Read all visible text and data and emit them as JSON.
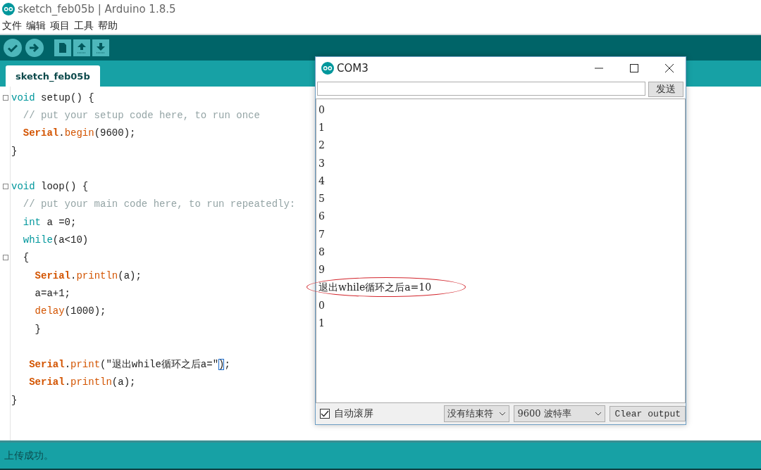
{
  "window": {
    "title": "sketch_feb05b | Arduino 1.8.5"
  },
  "menu": [
    "文件",
    "编辑",
    "项目",
    "工具",
    "帮助"
  ],
  "toolbar": [
    {
      "kind": "verify"
    },
    {
      "kind": "upload"
    },
    {
      "kind": "new"
    },
    {
      "kind": "open"
    },
    {
      "kind": "save"
    }
  ],
  "tabs": [
    {
      "label": "sketch_feb05b",
      "selected": true
    }
  ],
  "editor": {
    "lines": [
      {
        "fold": true,
        "tokens": [
          {
            "kind": "keyword",
            "text": "void"
          },
          {
            "kind": "plain",
            "text": " setup() {"
          }
        ]
      },
      {
        "fold": false,
        "tokens": [
          {
            "kind": "comment",
            "text": "  // put your setup code here, to run once"
          }
        ]
      },
      {
        "fold": false,
        "tokens": [
          {
            "kind": "class",
            "text": "  Serial"
          },
          {
            "kind": "plain",
            "text": "."
          },
          {
            "kind": "function",
            "text": "begin"
          },
          {
            "kind": "plain",
            "text": "(9600);"
          }
        ]
      },
      {
        "fold": false,
        "tokens": [
          {
            "kind": "plain",
            "text": "}"
          }
        ]
      },
      {
        "fold": false
      },
      {
        "fold": true,
        "tokens": [
          {
            "kind": "keyword",
            "text": "void"
          },
          {
            "kind": "plain",
            "text": " loop() {"
          }
        ]
      },
      {
        "fold": false,
        "tokens": [
          {
            "kind": "comment",
            "text": "  // put your main code here, to run repeatedly:"
          }
        ]
      },
      {
        "fold": false,
        "tokens": [
          {
            "kind": "keyword",
            "text": "  int"
          },
          {
            "kind": "plain",
            "text": " a =0;"
          }
        ]
      },
      {
        "fold": false,
        "tokens": [
          {
            "kind": "keyword",
            "text": "  while"
          },
          {
            "kind": "plain",
            "text": "(a<10)"
          }
        ]
      },
      {
        "fold": true,
        "tokens": [
          {
            "kind": "plain",
            "text": "  {"
          }
        ]
      },
      {
        "fold": false,
        "tokens": [
          {
            "kind": "class",
            "text": "    Serial"
          },
          {
            "kind": "plain",
            "text": "."
          },
          {
            "kind": "function",
            "text": "println"
          },
          {
            "kind": "plain",
            "text": "(a);"
          }
        ]
      },
      {
        "fold": false,
        "tokens": [
          {
            "kind": "plain",
            "text": "    a=a+1;"
          }
        ]
      },
      {
        "fold": false,
        "tokens": [
          {
            "kind": "function",
            "text": "    delay"
          },
          {
            "kind": "plain",
            "text": "(1000);"
          }
        ]
      },
      {
        "fold": false,
        "tokens": [
          {
            "kind": "plain",
            "text": "    }"
          }
        ]
      },
      {
        "fold": false
      },
      {
        "fold": false,
        "tokens": [
          {
            "kind": "class",
            "text": "   Serial"
          },
          {
            "kind": "plain",
            "text": "."
          },
          {
            "kind": "function",
            "text": "print"
          },
          {
            "kind": "plain",
            "text": "(\"退出while循环之后a=\""
          },
          {
            "kind": "match",
            "text": ")"
          },
          {
            "kind": "plain",
            "text": ";"
          }
        ]
      },
      {
        "fold": false,
        "tokens": [
          {
            "kind": "class",
            "text": "   Serial"
          },
          {
            "kind": "plain",
            "text": "."
          },
          {
            "kind": "function",
            "text": "println"
          },
          {
            "kind": "plain",
            "text": "(a);"
          }
        ]
      },
      {
        "fold": false,
        "tokens": [
          {
            "kind": "plain",
            "text": "}"
          }
        ]
      }
    ]
  },
  "serial_monitor": {
    "title": "COM3",
    "send_button": "发送",
    "output": [
      {
        "text": "0",
        "circled": false
      },
      {
        "text": "1",
        "circled": false
      },
      {
        "text": "2",
        "circled": false
      },
      {
        "text": "3",
        "circled": false
      },
      {
        "text": "4",
        "circled": false
      },
      {
        "text": "5",
        "circled": false
      },
      {
        "text": "6",
        "circled": false
      },
      {
        "text": "7",
        "circled": false
      },
      {
        "text": "8",
        "circled": false
      },
      {
        "text": "9",
        "circled": false
      },
      {
        "text": "退出while循环之后a=10",
        "circled": true
      },
      {
        "text": "0",
        "circled": false
      },
      {
        "text": "1",
        "circled": false
      }
    ],
    "autoscroll": {
      "label": "自动滚屏",
      "checked": true
    },
    "line_ending": "没有结束符",
    "baud": "9600 波特率",
    "clear_button": "Clear output"
  },
  "status_bar": {
    "message": "上传成功。"
  }
}
